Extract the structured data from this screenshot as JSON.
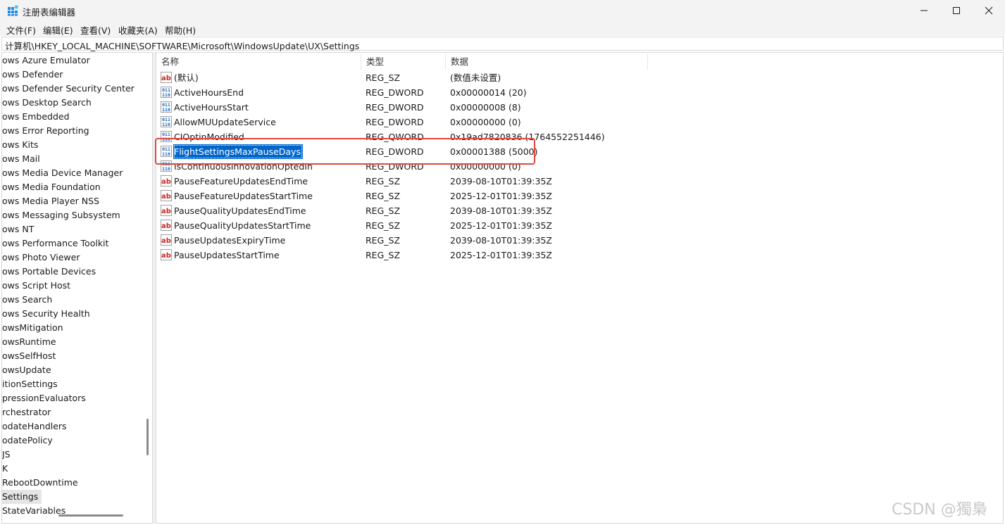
{
  "window": {
    "title": "注册表编辑器",
    "controls": {
      "minimize": "minimize",
      "maximize": "maximize",
      "close": "close"
    }
  },
  "menu": [
    "文件(F)",
    "编辑(E)",
    "查看(V)",
    "收藏夹(A)",
    "帮助(H)"
  ],
  "address": "计算机\\HKEY_LOCAL_MACHINE\\SOFTWARE\\Microsoft\\WindowsUpdate\\UX\\Settings",
  "tree": {
    "items": [
      "ows Azure Emulator",
      "ows Defender",
      "ows Defender Security Center",
      "ows Desktop Search",
      "ows Embedded",
      "ows Error Reporting",
      "ows Kits",
      "ows Mail",
      "ows Media Device Manager",
      "ows Media Foundation",
      "ows Media Player NSS",
      "ows Messaging Subsystem",
      "ows NT",
      "ows Performance Toolkit",
      "ows Photo Viewer",
      "ows Portable Devices",
      "ows Script Host",
      "ows Search",
      "ows Security Health",
      "owsMitigation",
      "owsRuntime",
      "owsSelfHost",
      "owsUpdate",
      "itionSettings",
      "pressionEvaluators",
      "rchestrator",
      "odateHandlers",
      "odatePolicy",
      "JS",
      "K",
      "RebootDowntime",
      "Settings",
      "StateVariables"
    ],
    "selected_index": 31
  },
  "columns": [
    "名称",
    "类型",
    "数据"
  ],
  "values": [
    {
      "name": "(默认)",
      "type": "REG_SZ",
      "data": "(数值未设置)",
      "icon": "string-value-icon"
    },
    {
      "name": "ActiveHoursEnd",
      "type": "REG_DWORD",
      "data": "0x00000014 (20)",
      "icon": "binary-value-icon"
    },
    {
      "name": "ActiveHoursStart",
      "type": "REG_DWORD",
      "data": "0x00000008 (8)",
      "icon": "binary-value-icon"
    },
    {
      "name": "AllowMUUpdateService",
      "type": "REG_DWORD",
      "data": "0x00000000 (0)",
      "icon": "binary-value-icon"
    },
    {
      "name": "CIOptinModified",
      "type": "REG_QWORD",
      "data": "0x19ad7820836 (1764552251446)",
      "icon": "binary-value-icon"
    },
    {
      "name": "FlightSettingsMaxPauseDays",
      "type": "REG_DWORD",
      "data": "0x00001388 (5000)",
      "icon": "binary-value-icon"
    },
    {
      "name": "IsContinuousInnovationOptedIn",
      "type": "REG_DWORD",
      "data": "0x00000000 (0)",
      "icon": "binary-value-icon"
    },
    {
      "name": "PauseFeatureUpdatesEndTime",
      "type": "REG_SZ",
      "data": "2039-08-10T01:39:35Z",
      "icon": "string-value-icon"
    },
    {
      "name": "PauseFeatureUpdatesStartTime",
      "type": "REG_SZ",
      "data": "2025-12-01T01:39:35Z",
      "icon": "string-value-icon"
    },
    {
      "name": "PauseQualityUpdatesEndTime",
      "type": "REG_SZ",
      "data": "2039-08-10T01:39:35Z",
      "icon": "string-value-icon"
    },
    {
      "name": "PauseQualityUpdatesStartTime",
      "type": "REG_SZ",
      "data": "2025-12-01T01:39:35Z",
      "icon": "string-value-icon"
    },
    {
      "name": "PauseUpdatesExpiryTime",
      "type": "REG_SZ",
      "data": "2039-08-10T01:39:35Z",
      "icon": "string-value-icon"
    },
    {
      "name": "PauseUpdatesStartTime",
      "type": "REG_SZ",
      "data": "2025-12-01T01:39:35Z",
      "icon": "string-value-icon"
    }
  ],
  "selected_value_index": 5,
  "watermark": "CSDN @獨梟",
  "colors": {
    "selection": "#0066cc",
    "highlight_box": "#e0483c",
    "titlebar": "#f3f3f3"
  }
}
